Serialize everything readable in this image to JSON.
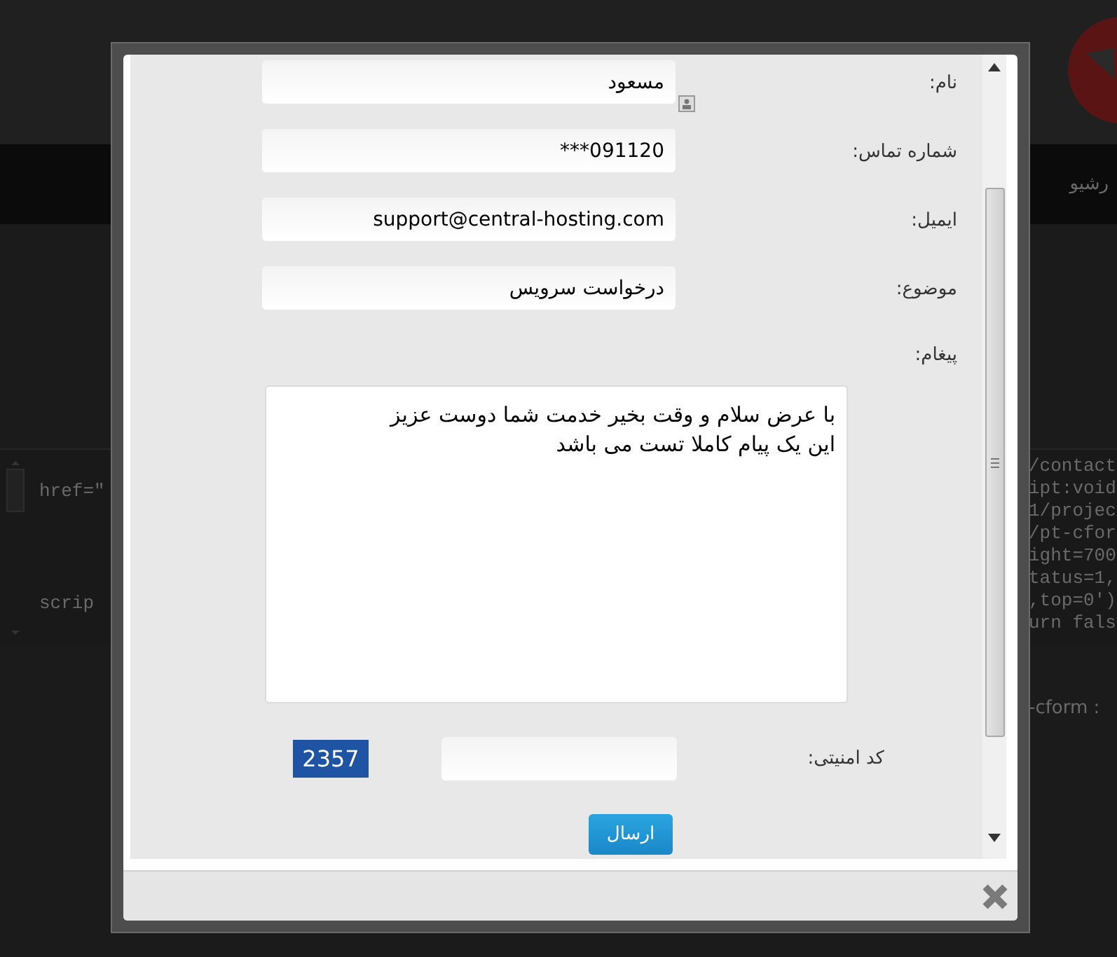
{
  "background": {
    "nav_item": "رشیو",
    "code_left": [
      "href=\"",
      "scrip"
    ],
    "code_right": [
      "/contact",
      "ipt:void",
      "1/projec",
      "/pt-cfor",
      "ight=700",
      "tatus=1,",
      ",top=0')",
      "urn fals"
    ],
    "footer_text": "-cform :"
  },
  "form": {
    "fields": [
      {
        "label": "نام:",
        "value": "مسعود",
        "contact_icon": true
      },
      {
        "label": "شماره تماس:",
        "value": "091120***",
        "contact_icon": false
      },
      {
        "label": "ایمیل:",
        "value": "support@central-hosting.com",
        "contact_icon": false
      },
      {
        "label": "موضوع:",
        "value": "درخواست سرویس",
        "contact_icon": false
      }
    ],
    "message": {
      "label": "پیغام:",
      "value": "با عرض سلام و وقت بخیر خدمت شما دوست عزیز\nاین یک پیام کاملا تست می باشد"
    },
    "captcha": {
      "label": "کد امنیتی:",
      "code": "2357"
    },
    "submit": "ارسال"
  }
}
